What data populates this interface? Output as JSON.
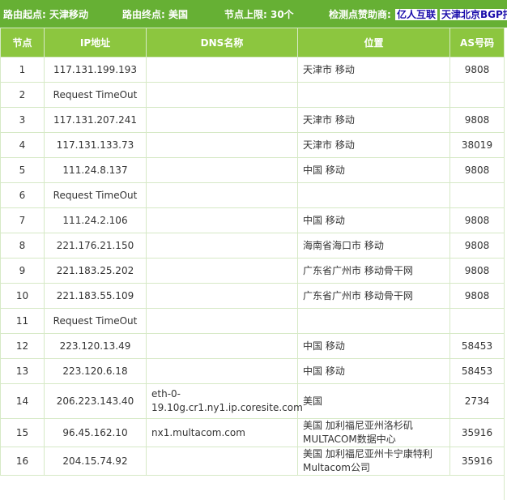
{
  "header": {
    "start_label": "路由起点: 天津移动",
    "end_label": "路由终点: 美国",
    "limit_label": "节点上限: 30个",
    "sponsor_label": "检测点赞助商:",
    "sponsor_links": [
      "亿人互联",
      "天津北京BGP托"
    ]
  },
  "table": {
    "columns": [
      "节点",
      "IP地址",
      "DNS名称",
      "位置",
      "AS号码"
    ],
    "rows": [
      {
        "hop": "1",
        "ip": "117.131.199.193",
        "dns": "",
        "location": "天津市 移动",
        "as": "9808"
      },
      {
        "hop": "2",
        "ip": "Request TimeOut",
        "dns": "",
        "location": "",
        "as": ""
      },
      {
        "hop": "3",
        "ip": "117.131.207.241",
        "dns": "",
        "location": "天津市 移动",
        "as": "9808"
      },
      {
        "hop": "4",
        "ip": "117.131.133.73",
        "dns": "",
        "location": "天津市 移动",
        "as": "38019"
      },
      {
        "hop": "5",
        "ip": "111.24.8.137",
        "dns": "",
        "location": "中国 移动",
        "as": "9808"
      },
      {
        "hop": "6",
        "ip": "Request TimeOut",
        "dns": "",
        "location": "",
        "as": ""
      },
      {
        "hop": "7",
        "ip": "111.24.2.106",
        "dns": "",
        "location": "中国 移动",
        "as": "9808"
      },
      {
        "hop": "8",
        "ip": "221.176.21.150",
        "dns": "",
        "location": "海南省海口市 移动",
        "as": "9808"
      },
      {
        "hop": "9",
        "ip": "221.183.25.202",
        "dns": "",
        "location": "广东省广州市 移动骨干网",
        "as": "9808"
      },
      {
        "hop": "10",
        "ip": "221.183.55.109",
        "dns": "",
        "location": "广东省广州市 移动骨干网",
        "as": "9808"
      },
      {
        "hop": "11",
        "ip": "Request TimeOut",
        "dns": "",
        "location": "",
        "as": ""
      },
      {
        "hop": "12",
        "ip": "223.120.13.49",
        "dns": "",
        "location": "中国 移动",
        "as": "58453"
      },
      {
        "hop": "13",
        "ip": "223.120.6.18",
        "dns": "",
        "location": "中国 移动",
        "as": "58453"
      },
      {
        "hop": "14",
        "ip": "206.223.143.40",
        "dns": "eth-0-19.10g.cr1.ny1.ip.coresite.com",
        "location": "美国",
        "as": "2734"
      },
      {
        "hop": "15",
        "ip": "96.45.162.10",
        "dns": "nx1.multacom.com",
        "location": "美国 加利福尼亚州洛杉矶MULTACOM数据中心",
        "as": "35916"
      },
      {
        "hop": "16",
        "ip": "204.15.74.92",
        "dns": "",
        "location": "美国 加利福尼亚州卡宁康特利Multacom公司",
        "as": "35916"
      }
    ]
  },
  "colors": {
    "header_bg": "#66b034",
    "th_bg": "#8cc63f",
    "border": "#d6e9c6",
    "link": "#1a0dab"
  }
}
